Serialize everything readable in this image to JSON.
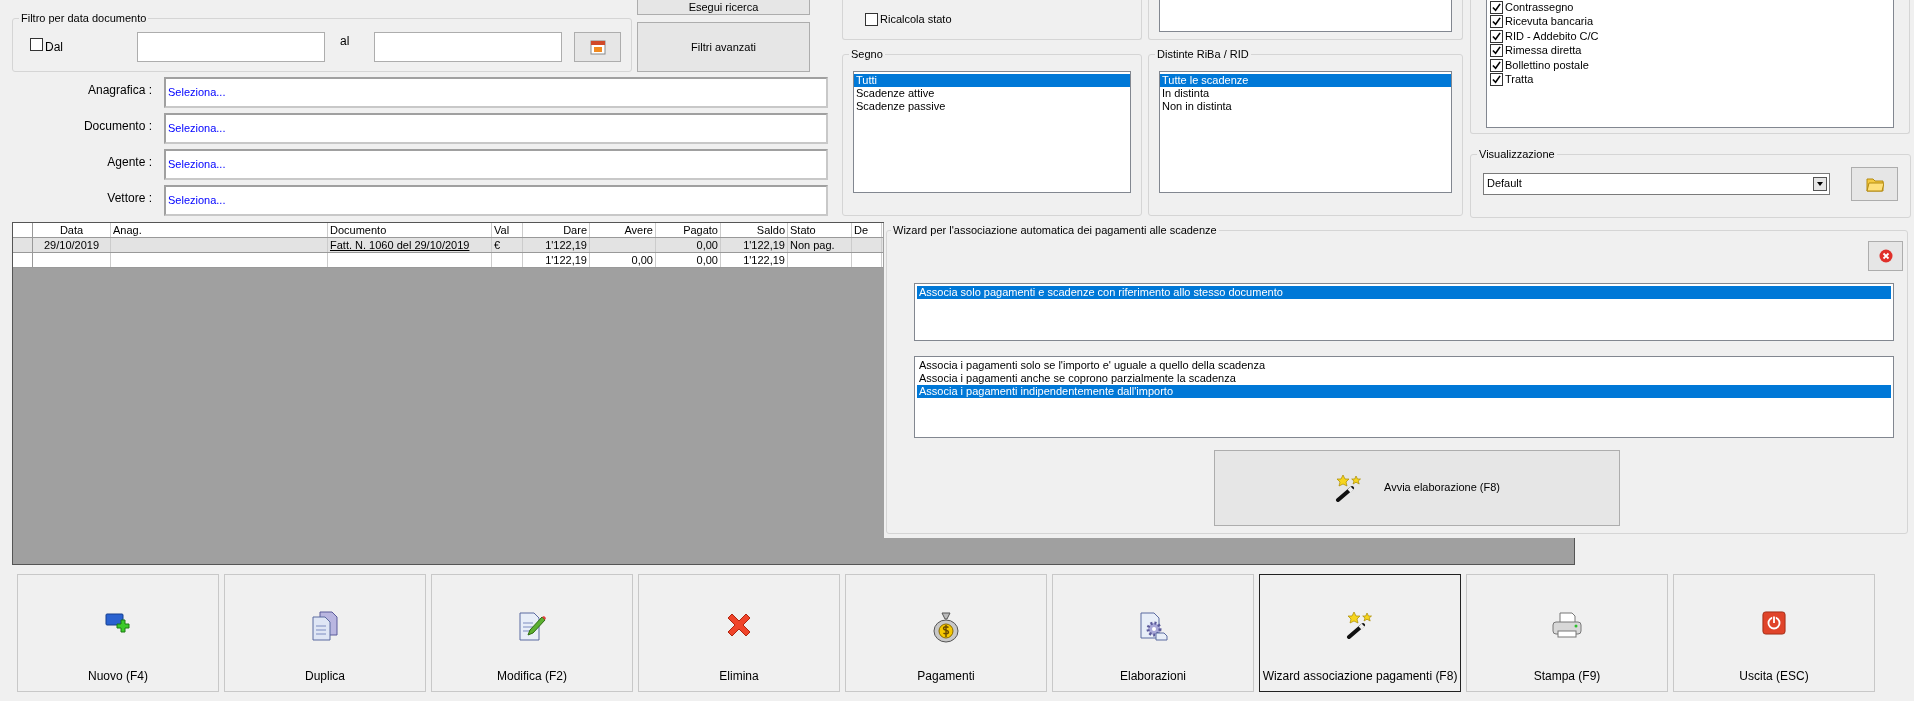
{
  "search_button": "Esegui ricerca",
  "date_filter": {
    "title": "Filtro per data documento",
    "from_label": "Dal",
    "from_checked": false,
    "to_label": "al"
  },
  "advanced_filters_button": "Filtri avanzati",
  "lookups": [
    {
      "label": "Anagrafica :",
      "value": "Seleziona..."
    },
    {
      "label": "Documento :",
      "value": "Seleziona..."
    },
    {
      "label": "Agente :",
      "value": "Seleziona..."
    },
    {
      "label": "Vettore :",
      "value": "Seleziona..."
    }
  ],
  "recalc": {
    "label": "Ricalcola stato",
    "checked": false
  },
  "segno": {
    "title": "Segno",
    "items": [
      {
        "label": "Tutti",
        "selected": true
      },
      {
        "label": "Scadenze attive",
        "selected": false
      },
      {
        "label": "Scadenze passive",
        "selected": false
      }
    ]
  },
  "distinte": {
    "title": "Distinte RiBa / RID",
    "items": [
      {
        "label": "Tutte le scadenze",
        "selected": true
      },
      {
        "label": "In distinta",
        "selected": false
      },
      {
        "label": "Non in distinta",
        "selected": false
      }
    ]
  },
  "payment_types": [
    {
      "label": "Contrassegno",
      "checked": true
    },
    {
      "label": "Ricevuta bancaria",
      "checked": true
    },
    {
      "label": "RID - Addebito C/C",
      "checked": true
    },
    {
      "label": "Rimessa diretta",
      "checked": true
    },
    {
      "label": "Bollettino postale",
      "checked": true
    },
    {
      "label": "Tratta",
      "checked": true
    }
  ],
  "visualizzazione": {
    "title": "Visualizzazione",
    "value": "Default"
  },
  "table": {
    "columns": [
      "Data",
      "Anag.",
      "Documento",
      "Val",
      "Dare",
      "Avere",
      "Pagato",
      "Saldo",
      "Stato",
      "De"
    ],
    "rows": [
      {
        "selected": true,
        "cells": [
          "29/10/2019",
          null,
          "Fatt. N. 1060 del 29/10/2019",
          "€",
          "1'122,19",
          null,
          "0,00",
          "1'122,19",
          "Non pag.",
          null
        ]
      },
      {
        "selected": false,
        "cells": [
          null,
          null,
          null,
          null,
          "1'122,19",
          "0,00",
          "0,00",
          "1'122,19",
          null,
          null
        ]
      }
    ]
  },
  "wizard": {
    "title": "Wizard per l'associazione automatica dei pagamenti alle scadenze",
    "match_options": [
      {
        "label": "Associa solo pagamenti e scadenze con riferimento allo stesso documento",
        "selected": true
      }
    ],
    "amount_options": [
      {
        "label": "Associa i pagamenti solo se l'importo e' uguale a quello della scadenza",
        "selected": false
      },
      {
        "label": "Associa i pagamenti anche se coprono parzialmente la scadenza",
        "selected": false
      },
      {
        "label": "Associa i pagamenti indipendentemente dall'importo",
        "selected": true
      }
    ],
    "start_button": "Avvia elaborazione (F8)"
  },
  "actions": [
    {
      "label": "Nuovo (F4)",
      "kind": "new",
      "selected": false
    },
    {
      "label": "Duplica",
      "kind": "duplicate",
      "selected": false
    },
    {
      "label": "Modifica (F2)",
      "kind": "edit",
      "selected": false
    },
    {
      "label": "Elimina",
      "kind": "delete",
      "selected": false
    },
    {
      "label": "Pagamenti",
      "kind": "money",
      "selected": false
    },
    {
      "label": "Elaborazioni",
      "kind": "process",
      "selected": false
    },
    {
      "label": "Wizard associazione pagamenti (F8)",
      "kind": "wand",
      "selected": true
    },
    {
      "label": "Stampa (F9)",
      "kind": "print",
      "selected": false
    },
    {
      "label": "Uscita (ESC)",
      "kind": "exit",
      "selected": false
    }
  ]
}
